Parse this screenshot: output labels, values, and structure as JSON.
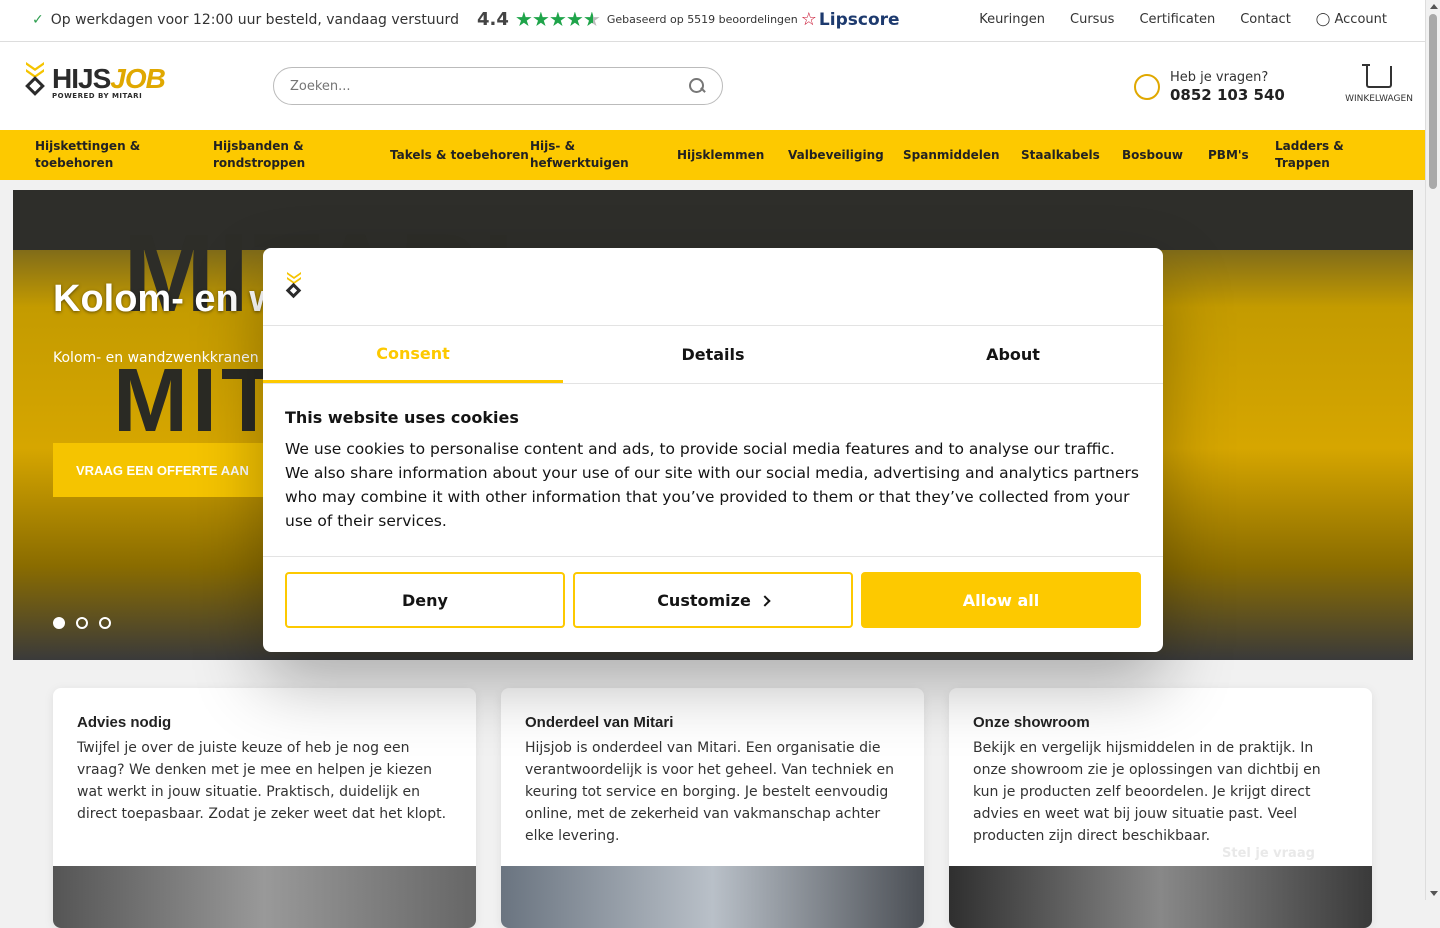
{
  "topbar": {
    "shipping": "Op werkdagen voor 12:00 uur besteld, vandaag verstuurd",
    "rating_score": "4.4",
    "rating_based": "Gebaseerd op 5519 beoordelingen",
    "lipscore": "Lipscore",
    "links": [
      "Keuringen",
      "Cursus",
      "Certificaten",
      "Contact",
      "Account"
    ]
  },
  "header": {
    "logo_main": "HIJS",
    "logo_accent": "JOB",
    "logo_sub": "POWERED BY MITARI",
    "search_placeholder": "Zoeken...",
    "help_question": "Heb je vragen?",
    "help_phone": "0852 103 540",
    "cart_label": "WINKELWAGEN"
  },
  "categories": [
    {
      "label": "Hijskettingen & toebehoren"
    },
    {
      "label": "Hijsbanden & rondstroppen"
    },
    {
      "label": "Takels & toebehoren"
    },
    {
      "label": "Hijs- & hefwerktuigen"
    },
    {
      "label": "Hijsklemmen"
    },
    {
      "label": "Valbeveiliging"
    },
    {
      "label": "Spanmiddelen"
    },
    {
      "label": "Staalkabels"
    },
    {
      "label": "Bosbouw"
    },
    {
      "label": "PBM's"
    },
    {
      "label": "Ladders & Trappen"
    }
  ],
  "hero": {
    "title": "Kolom- en w",
    "subtitle": "Kolom- en wandzwenkkranen in",
    "cta": "VRAAG EEN OFFERTE AAN",
    "bg_text_1": "MITARI",
    "bg_text_2": "MITARI"
  },
  "consent": {
    "tabs": [
      "Consent",
      "Details",
      "About"
    ],
    "heading": "This website uses cookies",
    "body": "We use cookies to personalise content and ads, to provide social media features and to analyse our traffic. We also share information about your use of our site with our social media, advertising and analytics partners who may combine it with other information that you’ve provided to them or that they’ve collected from your use of their services.",
    "deny": "Deny",
    "customize": "Customize",
    "allow": "Allow all"
  },
  "cards": [
    {
      "title": "Advies nodig",
      "text": "Twijfel je over de juiste keuze of heb je nog een vraag? We denken met je mee en helpen je kiezen wat werkt in jouw situatie. Praktisch, duidelijk en direct toepasbaar. Zodat je zeker weet dat het klopt."
    },
    {
      "title": "Onderdeel van Mitari",
      "text": "Hijsjob is onderdeel van Mitari. Een organisatie die verantwoordelijk is voor het geheel. Van techniek en keuring tot service en borging. Je bestelt eenvoudig online, met de zekerheid van vakmanschap achter elke levering."
    },
    {
      "title": "Onze showroom",
      "text": "Bekijk en vergelijk hijsmiddelen in de praktijk. In onze showroom zie je oplossingen van dichtbij en kun je producten zelf beoordelen. Je krijgt direct advies en weet wat bij jouw situatie past. Veel producten zijn direct beschikbaar."
    }
  ],
  "chat": {
    "label": "Stel je vraag"
  },
  "colors": {
    "brand_yellow": "#fdc900",
    "rating_green": "#1fa44a",
    "text_dark": "#141414"
  }
}
